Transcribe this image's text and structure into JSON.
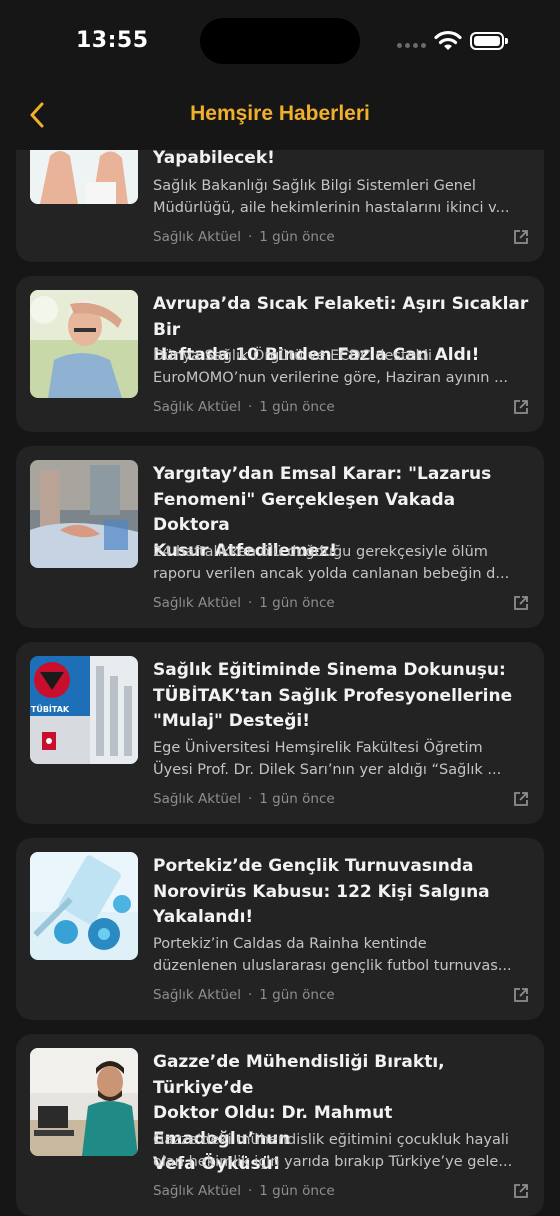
{
  "status_bar": {
    "time": "13:55"
  },
  "nav": {
    "title": "Hemşire Haberleri",
    "back_icon": "chevron-left-icon"
  },
  "colors": {
    "accent": "#f0b02c",
    "background": "#161616",
    "card": "#232323"
  },
  "articles": [
    {
      "title_lines": [
        "Yapabilecek!"
      ],
      "summary_lines": [
        "Sağlık Bakanlığı Sağlık Bilgi Sistemleri Genel",
        "Müdürlüğü, aile hekimlerinin hastalarını ikinci v..."
      ],
      "source": "Sağlık Aktüel",
      "time": "1 gün önce",
      "icon": "external-link-icon"
    },
    {
      "title_lines": [
        "Avrupa’da Sıcak Felaketi: Aşırı Sıcaklar Bir",
        "Haftada 10 Binden Fazla Can Aldı!"
      ],
      "summary_lines": [
        "Dünya Sağlık Örgütü ve ECDC destekli",
        "EuroMOMO’nun verilerine göre, Haziran ayının ..."
      ],
      "source": "Sağlık Aktüel",
      "time": "1 gün önce",
      "icon": "external-link-icon"
    },
    {
      "title_lines": [
        "Yargıtay’dan Emsal Karar: \"Lazarus",
        "Fenomeni\" Gerçekleşen Vakada Doktora",
        "Kusur Atfedilemez!"
      ],
      "summary_lines": [
        "24 haftalıkken ölü doğduğu gerekçesiyle ölüm",
        "raporu verilen ancak yolda canlanan bebeğin d..."
      ],
      "source": "Sağlık Aktüel",
      "time": "1 gün önce",
      "icon": "external-link-icon"
    },
    {
      "title_lines": [
        "Sağlık Eğitiminde Sinema Dokunuşu:",
        "TÜBİTAK’tan Sağlık Profesyonellerine",
        "\"Mulaj\" Desteği!"
      ],
      "summary_lines": [
        "Ege Üniversitesi Hemşirelik Fakültesi Öğretim",
        "Üyesi Prof. Dr. Dilek Sarı’nın yer aldığı “Sağlık ..."
      ],
      "source": "Sağlık Aktüel",
      "time": "1 gün önce",
      "icon": "external-link-icon",
      "logo_text": "TÜBİTAK"
    },
    {
      "title_lines": [
        "Portekiz’de Gençlik Turnuvasında",
        "Norovirüs Kabusu: 122 Kişi Salgına",
        "Yakalandı!"
      ],
      "summary_lines": [
        "Portekiz’in Caldas da Rainha kentinde",
        "düzenlenen uluslararası gençlik futbol turnuvas..."
      ],
      "source": "Sağlık Aktüel",
      "time": "1 gün önce",
      "icon": "external-link-icon"
    },
    {
      "title_lines": [
        "Gazze’de Mühendisliği Bıraktı, Türkiye’de",
        "Doktor Oldu: Dr. Mahmut Emadoğlu’nun",
        "Vefa Öyküsü!"
      ],
      "summary_lines": [
        "Gazze'deki mühendislik eğitimini çocukluk hayali",
        "olan hekimlik için yarıda bırakıp Türkiye’ye gele..."
      ],
      "source": "Sağlık Aktüel",
      "time": "1 gün önce",
      "icon": "external-link-icon"
    }
  ]
}
